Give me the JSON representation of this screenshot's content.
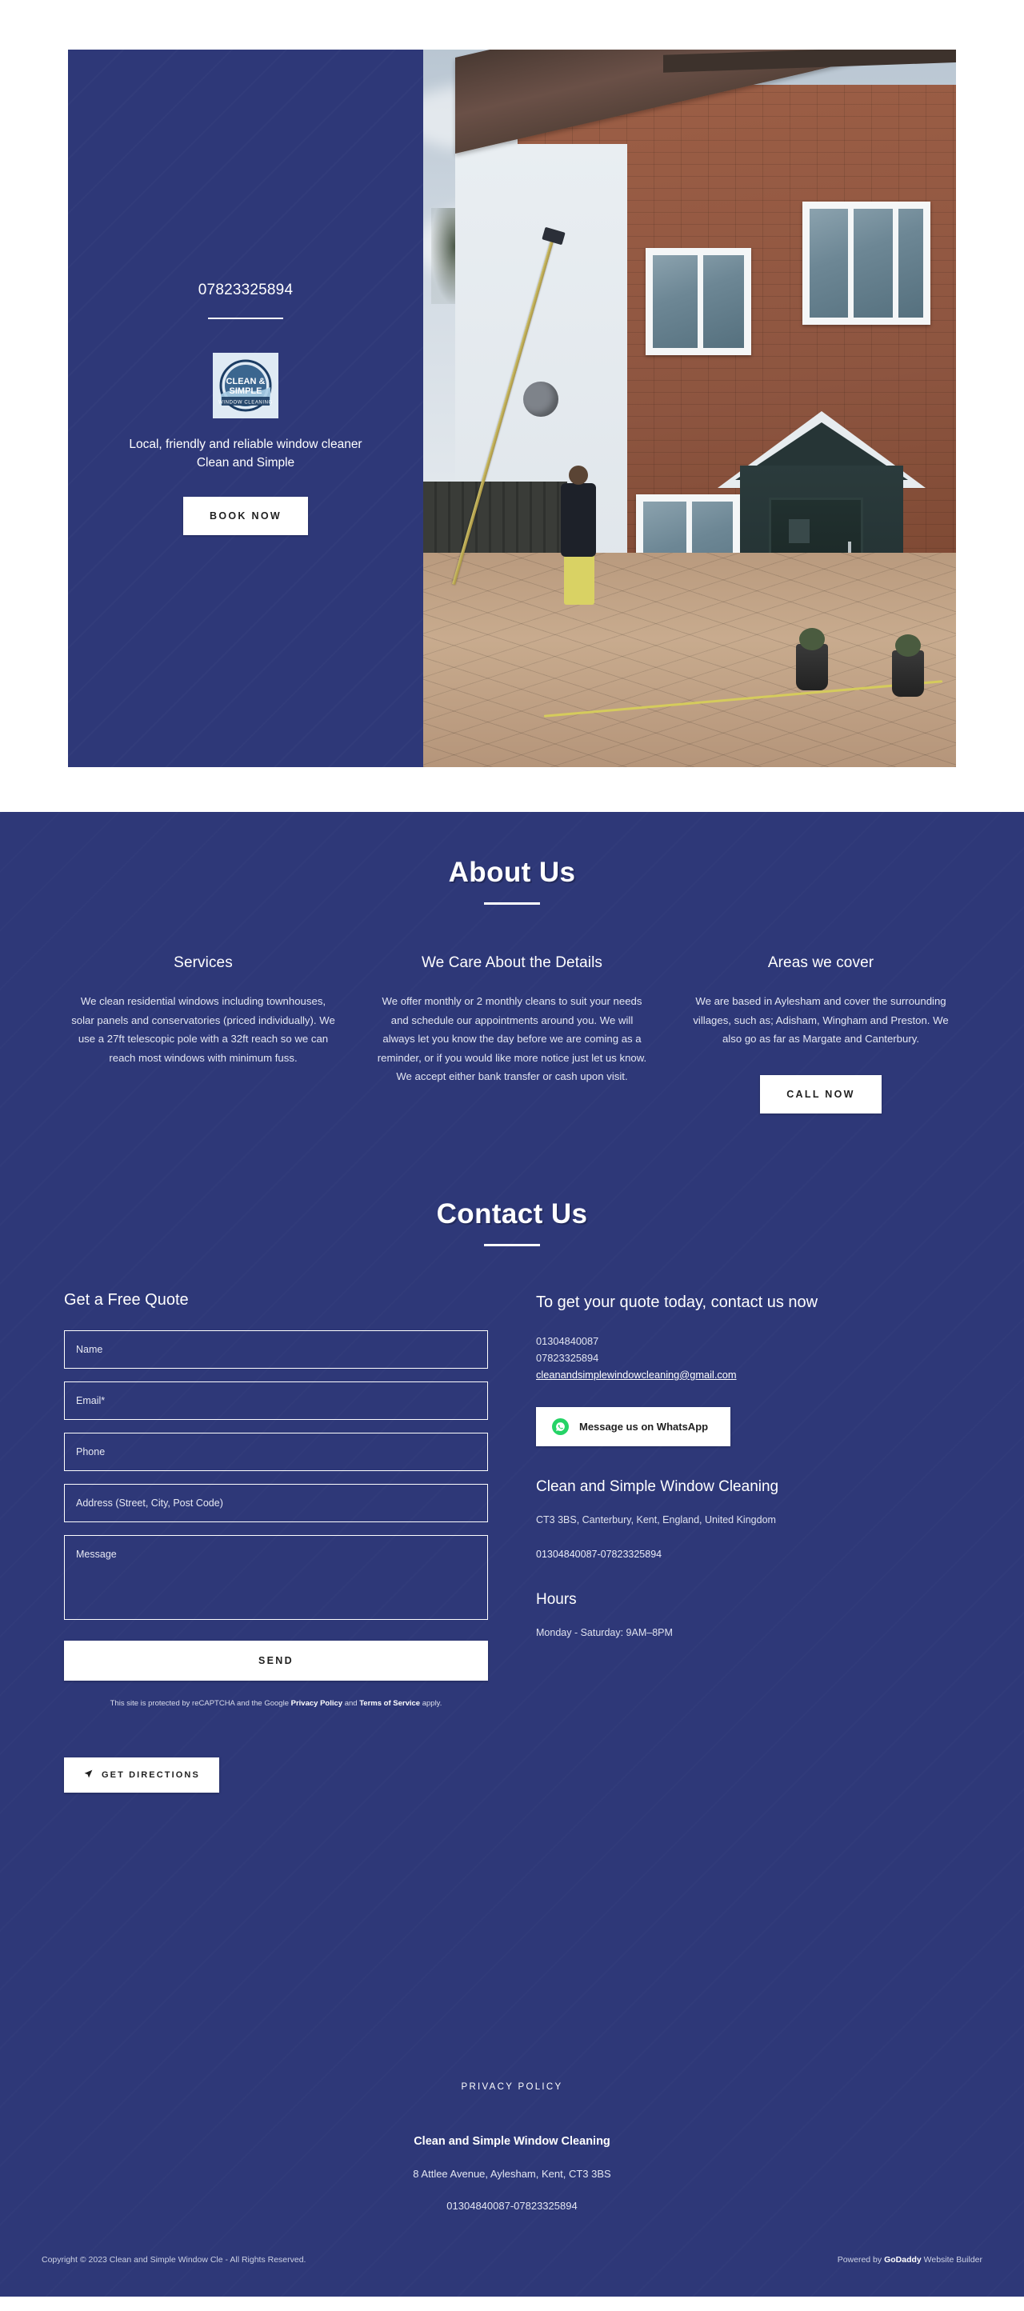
{
  "hero": {
    "phone": "07823325894",
    "logo_line1": "CLEAN &",
    "logo_line2": "SIMPLE",
    "logo_line3": "WINDOW CLEANING",
    "tagline": "Local, friendly and reliable window cleaner Clean and Simple",
    "cta_label": "BOOK NOW"
  },
  "about": {
    "title": "About Us",
    "columns": [
      {
        "heading": "Services",
        "body": "We clean residential windows including townhouses, solar panels and conservatories (priced individually). We use a 27ft telescopic pole with a 32ft reach so we can reach most windows with minimum fuss."
      },
      {
        "heading": "We Care About the Details",
        "body": "We offer monthly or 2 monthly cleans to suit your needs and schedule our appointments around you. We will always let you know the day before we are coming as a reminder, or if you would like more notice just let us know. We accept either bank transfer or cash upon visit."
      },
      {
        "heading": "Areas we cover",
        "body": "We are based in Aylesham and cover the surrounding villages, such as; Adisham, Wingham and Preston. We also go as far as Margate and Canterbury.",
        "button_label": "CALL NOW"
      }
    ]
  },
  "contact": {
    "title": "Contact Us",
    "form": {
      "heading": "Get a Free Quote",
      "name_placeholder": "Name",
      "email_placeholder": "Email*",
      "phone_placeholder": "Phone",
      "address_placeholder": "Address (Street, City, Post Code)",
      "message_placeholder": "Message",
      "send_label": "SEND",
      "recaptcha_prefix": "This site is protected by reCAPTCHA and the Google ",
      "recaptcha_privacy": "Privacy Policy",
      "recaptcha_and": " and ",
      "recaptcha_terms": "Terms of Service",
      "recaptcha_suffix": " apply."
    },
    "info": {
      "heading": "To get your quote today, contact us now",
      "phone1": "01304840087",
      "phone2": "07823325894",
      "email": "cleanandsimplewindowcleaning@gmail.com",
      "whatsapp_label": "Message us on WhatsApp",
      "business_name": "Clean and Simple Window Cleaning",
      "business_address": "CT3 3BS, Canterbury, Kent, England, United Kingdom",
      "business_phones": "01304840087-07823325894",
      "hours_heading": "Hours",
      "hours_value": "Monday - Saturday: 9AM–8PM"
    },
    "directions_label": "GET DIRECTIONS"
  },
  "footer": {
    "privacy_label": "PRIVACY POLICY",
    "name": "Clean and Simple Window Cleaning",
    "address": "8 Attlee Avenue, Aylesham, Kent, CT3 3BS",
    "phones": "01304840087-07823325894",
    "copyright": "Copyright © 2023 Clean and Simple Window Cle - All Rights Reserved.",
    "powered_prefix": "Powered by ",
    "powered_brand": "GoDaddy",
    "powered_suffix": " Website Builder"
  },
  "colors": {
    "brand_navy": "#2e3878",
    "button_white": "#ffffff",
    "whatsapp_green": "#25d366"
  }
}
